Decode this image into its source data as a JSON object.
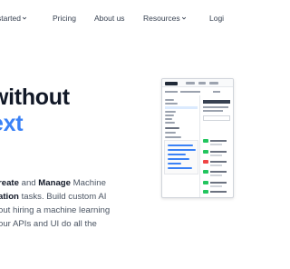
{
  "nav": {
    "started": "started",
    "pricing": "Pricing",
    "about": "About us",
    "resources": "Resources",
    "login": "Logi"
  },
  "hero": {
    "line1": "without",
    "line2": "ext"
  },
  "description": {
    "line1_a": "reate",
    "line1_and": " and ",
    "line1_b": "Manage",
    "line1_c": " Machine",
    "line2_a": "ation",
    "line2_b": " tasks. Build custom AI",
    "line3": "out hiring a machine learning",
    "line4": "our APIs and UI do all the"
  },
  "colors": {
    "accent": "#3b82f6",
    "badge_green": "#22c55e",
    "badge_red": "#ef4444"
  }
}
